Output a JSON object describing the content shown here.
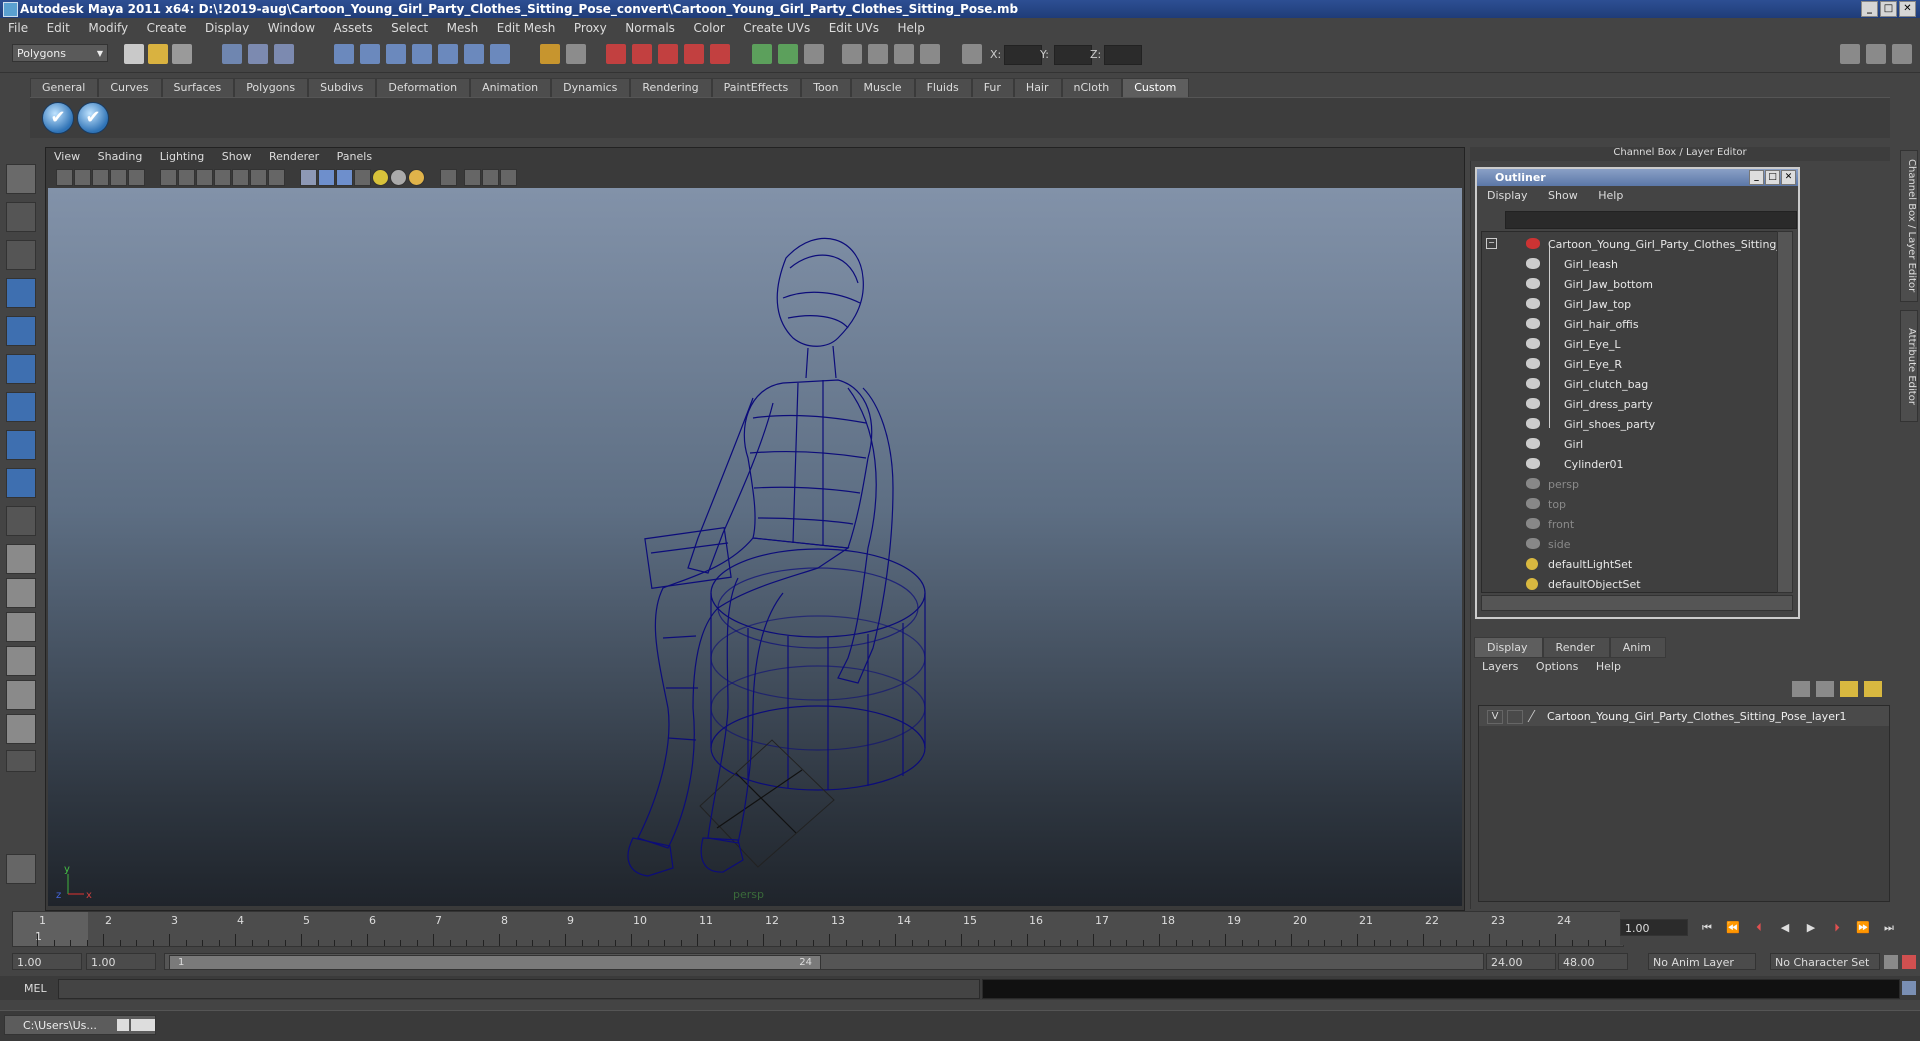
{
  "window": {
    "title": "Autodesk Maya 2011 x64: D:\\!2019-aug\\Cartoon_Young_Girl_Party_Clothes_Sitting_Pose_convert\\Cartoon_Young_Girl_Party_Clothes_Sitting_Pose.mb",
    "controls": [
      "_",
      "□",
      "✕"
    ]
  },
  "menubar": [
    "File",
    "Edit",
    "Modify",
    "Create",
    "Display",
    "Window",
    "Assets",
    "Select",
    "Mesh",
    "Edit Mesh",
    "Proxy",
    "Normals",
    "Color",
    "Create UVs",
    "Edit UVs",
    "Help"
  ],
  "statusline": {
    "mode_menu": "Polygons",
    "coord_labels": [
      "X:",
      "Y:",
      "Z:"
    ]
  },
  "shelf": {
    "tabs": [
      "General",
      "Curves",
      "Surfaces",
      "Polygons",
      "Subdivs",
      "Deformation",
      "Animation",
      "Dynamics",
      "Rendering",
      "PaintEffects",
      "Toon",
      "Muscle",
      "Fluids",
      "Fur",
      "Hair",
      "nCloth",
      "Custom"
    ],
    "active_tab": "Custom",
    "icons": [
      "✔",
      "✔"
    ]
  },
  "viewport": {
    "menu": [
      "View",
      "Shading",
      "Lighting",
      "Show",
      "Renderer",
      "Panels"
    ],
    "camera_label": "persp",
    "axis_labels": {
      "x": "x",
      "y": "y",
      "z": "z"
    },
    "wire_color": "#0c0c7a"
  },
  "channel_box": {
    "header": "Channel Box / Layer Editor",
    "side_tabs": [
      "Channel Box / Layer Editor",
      "Attribute Editor"
    ]
  },
  "outliner": {
    "title": "Outliner",
    "menu": [
      "Display",
      "Show",
      "Help"
    ],
    "root": "Cartoon_Young_Girl_Party_Clothes_Sitting_Pos",
    "children": [
      "Girl_leash",
      "Girl_Jaw_bottom",
      "Girl_Jaw_top",
      "Girl_hair_offis",
      "Girl_Eye_L",
      "Girl_Eye_R",
      "Girl_clutch_bag",
      "Girl_dress_party",
      "Girl_shoes_party",
      "Girl",
      "Cylinder01"
    ],
    "cameras": [
      "persp",
      "top",
      "front",
      "side"
    ],
    "sets": [
      "defaultLightSet",
      "defaultObjectSet"
    ]
  },
  "layer_editor": {
    "tabs": [
      "Display",
      "Render",
      "Anim"
    ],
    "active_tab": "Display",
    "menu": [
      "Layers",
      "Options",
      "Help"
    ],
    "layers": [
      {
        "visible": "V",
        "name": "Cartoon_Young_Girl_Party_Clothes_Sitting_Pose_layer1"
      }
    ]
  },
  "timeline": {
    "ticks": [
      "1",
      "2",
      "3",
      "4",
      "5",
      "6",
      "7",
      "8",
      "9",
      "10",
      "11",
      "12",
      "13",
      "14",
      "15",
      "16",
      "17",
      "18",
      "19",
      "20",
      "21",
      "22",
      "23",
      "24"
    ],
    "current_frame": "1",
    "current_time_field": "1.00"
  },
  "range": {
    "start": "1.00",
    "playback_start": "1.00",
    "slider_start": "1",
    "slider_end": "24",
    "playback_end": "24.00",
    "end": "48.00",
    "anim_layer": "No Anim Layer",
    "character_set": "No Character Set"
  },
  "command_line": {
    "label": "MEL"
  },
  "taskbar": {
    "item": "C:\\Users\\Us..."
  }
}
